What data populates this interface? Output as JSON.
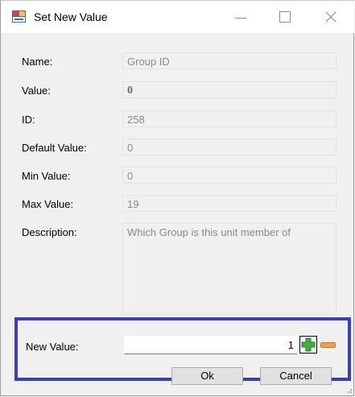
{
  "window": {
    "title": "Set New Value"
  },
  "fields": [
    {
      "label": "Name:",
      "value": "Group ID"
    },
    {
      "label": "Value:",
      "value": "0"
    },
    {
      "label": "ID:",
      "value": "258"
    },
    {
      "label": "Default Value:",
      "value": "0"
    },
    {
      "label": "Min Value:",
      "value": "0"
    },
    {
      "label": "Max Value:",
      "value": "19"
    },
    {
      "label": "Description:",
      "value": "Which Group is this unit member of"
    }
  ],
  "new_value": {
    "label": "New Value:",
    "value": "1"
  },
  "buttons": {
    "ok": "Ok",
    "cancel": "Cancel"
  },
  "icons": {
    "app": "app-icon",
    "increment": "plus-icon",
    "decrement": "minus-icon"
  },
  "colors": {
    "highlight": "#3b3fb5",
    "plus": "#3cb43c",
    "minus": "#f0a040"
  }
}
